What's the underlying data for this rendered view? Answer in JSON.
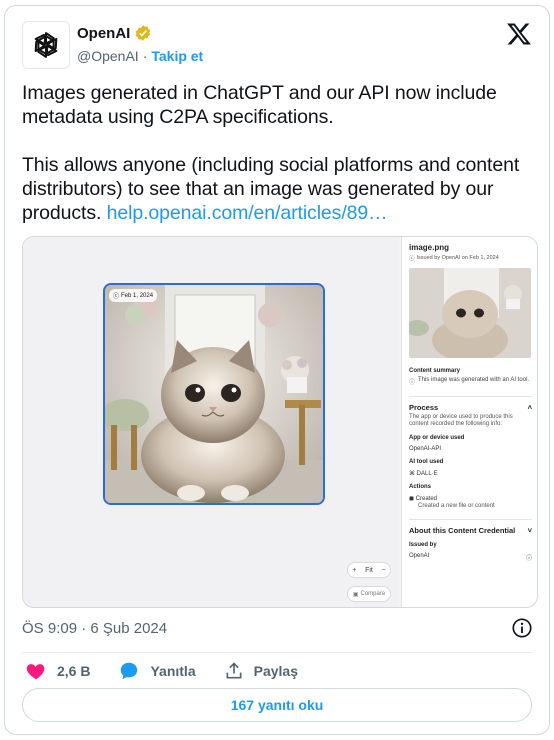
{
  "author": {
    "name": "OpenAI",
    "handle": "@OpenAI",
    "separator": "·",
    "follow_label": "Takip et"
  },
  "tweet": {
    "line1": "Images generated in ChatGPT and our API now include metadata using C2PA specifications.",
    "line2": "This allows anyone (including social platforms and content distributors) to see that an image was generated by our products.",
    "link": "help.openai.com/en/articles/89…"
  },
  "media": {
    "date_chip": "Feb 1, 2024",
    "zoom_fit": "Fit",
    "compare_label": "Compare",
    "panel": {
      "file_name": "image.png",
      "issued": "Issued by OpenAI on Feb 1, 2024",
      "content_summary_title": "Content summary",
      "content_summary_text": "This image was generated with an AI tool.",
      "process_title": "Process",
      "process_desc": "The app or device used to produce this content recorded the following info:",
      "app_label": "App or device used",
      "app_value": "OpenAI-API",
      "ai_tool_label": "AI tool used",
      "ai_tool_value": "DALL·E",
      "actions_label": "Actions",
      "action_name": "Created",
      "action_desc": "Created a new file or content",
      "about_title": "About this Content Credential",
      "issued_by_label": "Issued by",
      "issued_by_value": "OpenAI"
    }
  },
  "timestamp": "ÖS 9:09 · 6 Şub 2024",
  "actions": {
    "likes": "2,6 B",
    "reply_label": "Yanıtla",
    "share_label": "Paylaş"
  },
  "read_replies": "167 yanıtı oku",
  "colors": {
    "accent": "#1d9bf0",
    "like": "#f91880",
    "verified": "#e2b719",
    "frame": "#2e6bd6"
  }
}
